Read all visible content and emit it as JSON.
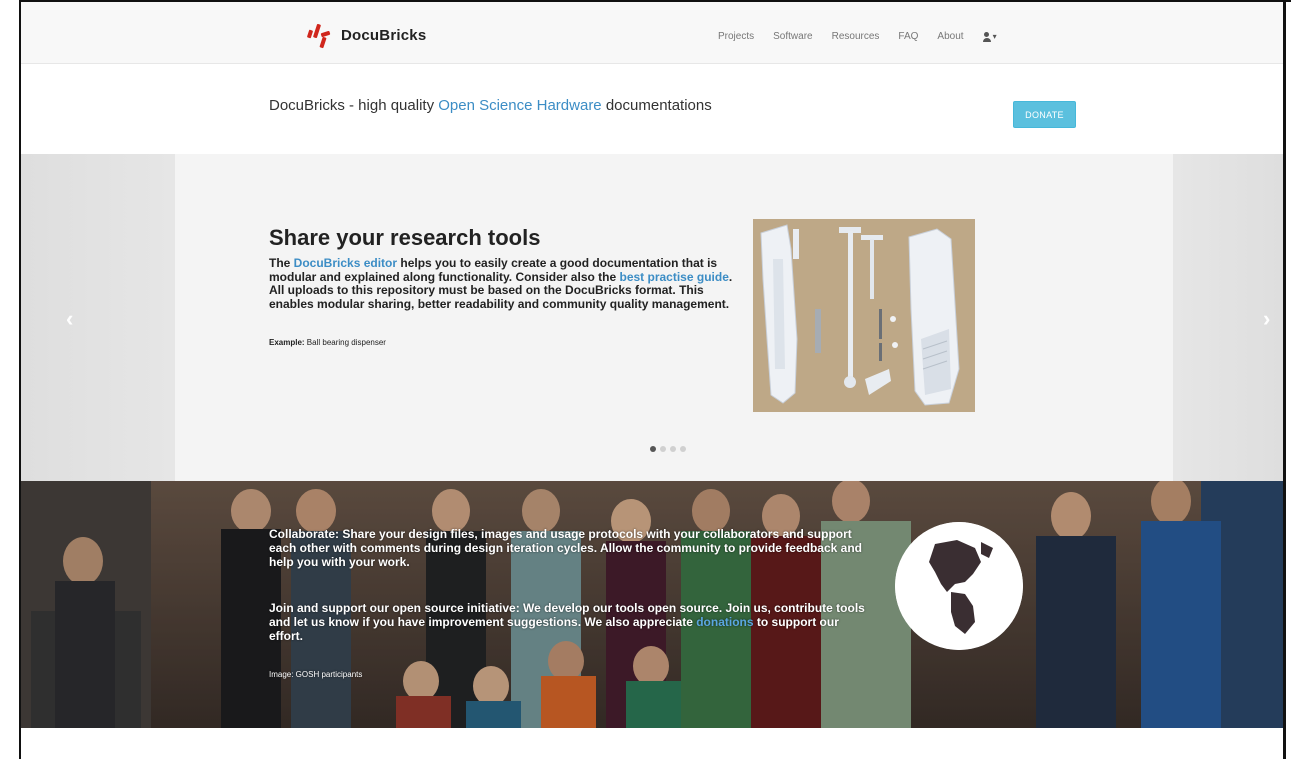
{
  "brand": {
    "name": "DocuBricks",
    "accent": "#d0261c"
  },
  "nav": {
    "links": [
      "Projects",
      "Software",
      "Resources",
      "FAQ",
      "About"
    ],
    "user_caret": "▾"
  },
  "tagline": {
    "prefix": "DocuBricks - high quality ",
    "link": "Open Science Hardware",
    "suffix": " documentations"
  },
  "donate": {
    "label": "DONATE",
    "color": "#5bc0de"
  },
  "carousel": {
    "prev_arrow": "‹",
    "next_arrow": "›",
    "title": "Share your research tools",
    "desc_1": "The ",
    "desc_link_1": "DocuBricks editor",
    "desc_2": " helps you to easily create a good documentation that is modular and explained along functionality. Consider also the ",
    "desc_link_2": "best practise guide",
    "desc_3": ". All uploads to this repository must be based on the DocuBricks format. This enables modular sharing, better readability and community quality management.",
    "example_label": "Example:",
    "example_value": " Ball bearing dispenser",
    "slides": 4,
    "active_slide": 1
  },
  "banner": {
    "collab_label": "Collaborate:",
    "collab_text": " Share your design files, images and usage protocols with your collaborators and support each other with comments during design iteration cycles. Allow the community to provide feedback and help you with your work.",
    "join_label": "Join and support our open source initiative:",
    "join_text": " We develop our tools open source. Join us, contribute tools and let us know if you have improvement suggestions. We also appreciate ",
    "join_link": "donations",
    "join_end": " to support our effort.",
    "credit": "Image: GOSH participants"
  }
}
